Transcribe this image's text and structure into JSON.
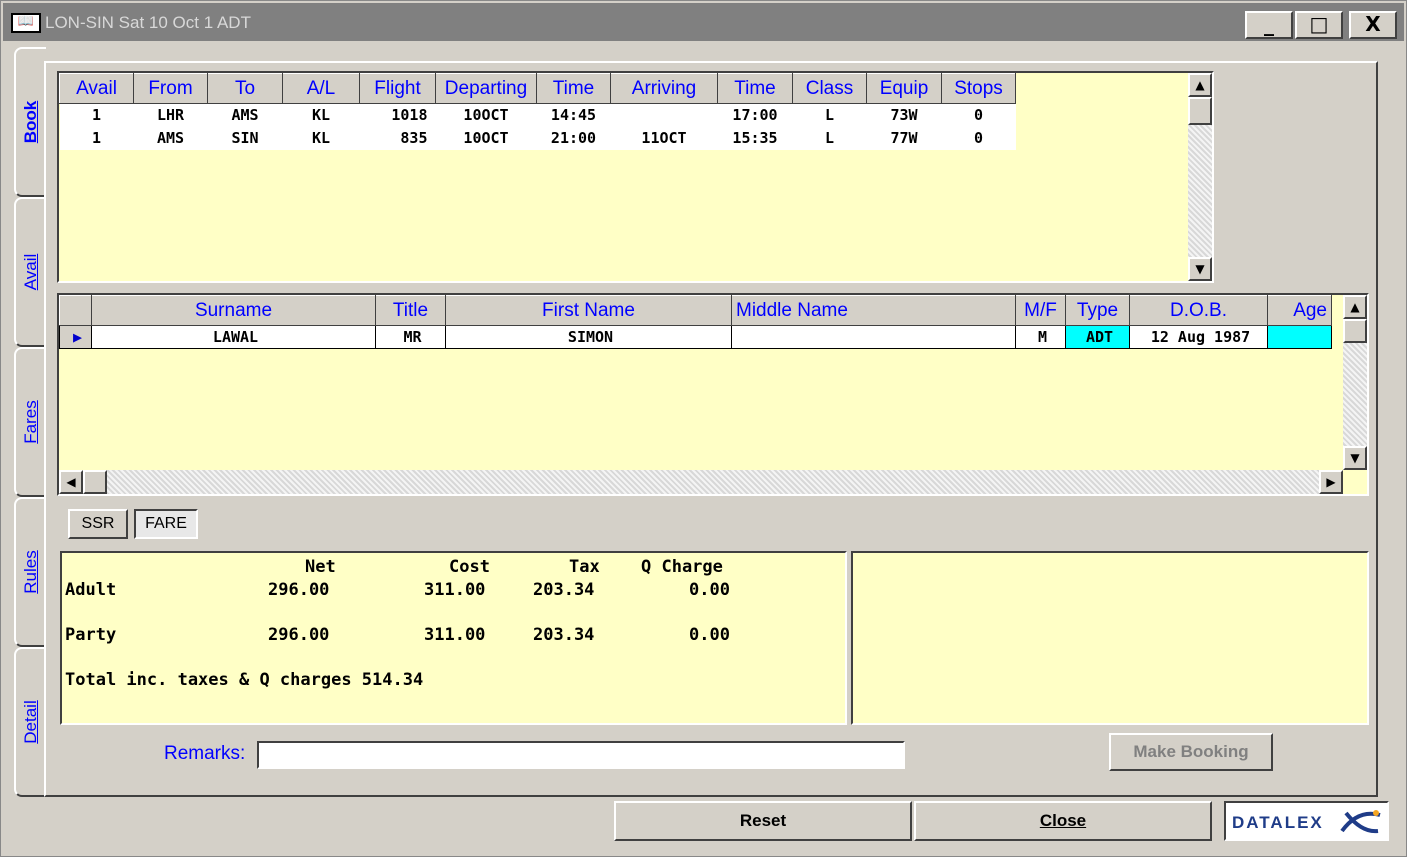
{
  "window": {
    "title": "LON-SIN Sat 10 Oct 1 ADT",
    "minimize": "_",
    "maximize": "□",
    "close": "X"
  },
  "tabs": [
    {
      "label": "Book",
      "active": true
    },
    {
      "label": "Avail",
      "active": false
    },
    {
      "label": "Fares",
      "active": false
    },
    {
      "label": "Rules",
      "active": false
    },
    {
      "label": "Detail",
      "active": false
    }
  ],
  "flights": {
    "headers": [
      "Avail",
      "From",
      "To",
      "A/L",
      "Flight",
      "Departing",
      "Time",
      "Arriving",
      "Time",
      "Class",
      "Equip",
      "Stops"
    ],
    "rows": [
      [
        "1",
        "LHR",
        "AMS",
        "KL",
        "1018",
        "10OCT",
        "14:45",
        "",
        "17:00",
        "L",
        "73W",
        "0"
      ],
      [
        "1",
        "AMS",
        "SIN",
        "KL",
        "835",
        "10OCT",
        "21:00",
        "11OCT",
        "15:35",
        "L",
        "77W",
        "0"
      ]
    ]
  },
  "passengers": {
    "headers": [
      "Surname",
      "Title",
      "First Name",
      "Middle Name",
      "M/F",
      "Type",
      "D.O.B.",
      "Age"
    ],
    "rows": [
      [
        "LAWAL",
        "MR",
        "SIMON",
        "",
        "M",
        "ADT",
        "12 Aug 1987",
        ""
      ]
    ]
  },
  "subtabs": {
    "ssr": "SSR",
    "fare": "FARE"
  },
  "fare": {
    "header": {
      "net": "Net",
      "cost": "Cost",
      "tax": "Tax",
      "qcharge": "Q Charge"
    },
    "adult": {
      "label": "Adult",
      "net": "296.00",
      "cost": "311.00",
      "tax": "203.34",
      "qcharge": "0.00"
    },
    "party": {
      "label": "Party",
      "net": "296.00",
      "cost": "311.00",
      "tax": "203.34",
      "qcharge": "0.00"
    },
    "total": "Total inc. taxes & Q charges 514.34"
  },
  "remarks": {
    "label": "Remarks:",
    "value": ""
  },
  "buttons": {
    "make_booking": "Make Booking",
    "reset": "Reset",
    "close": "Close"
  },
  "logo": {
    "text": "DATALEX"
  }
}
